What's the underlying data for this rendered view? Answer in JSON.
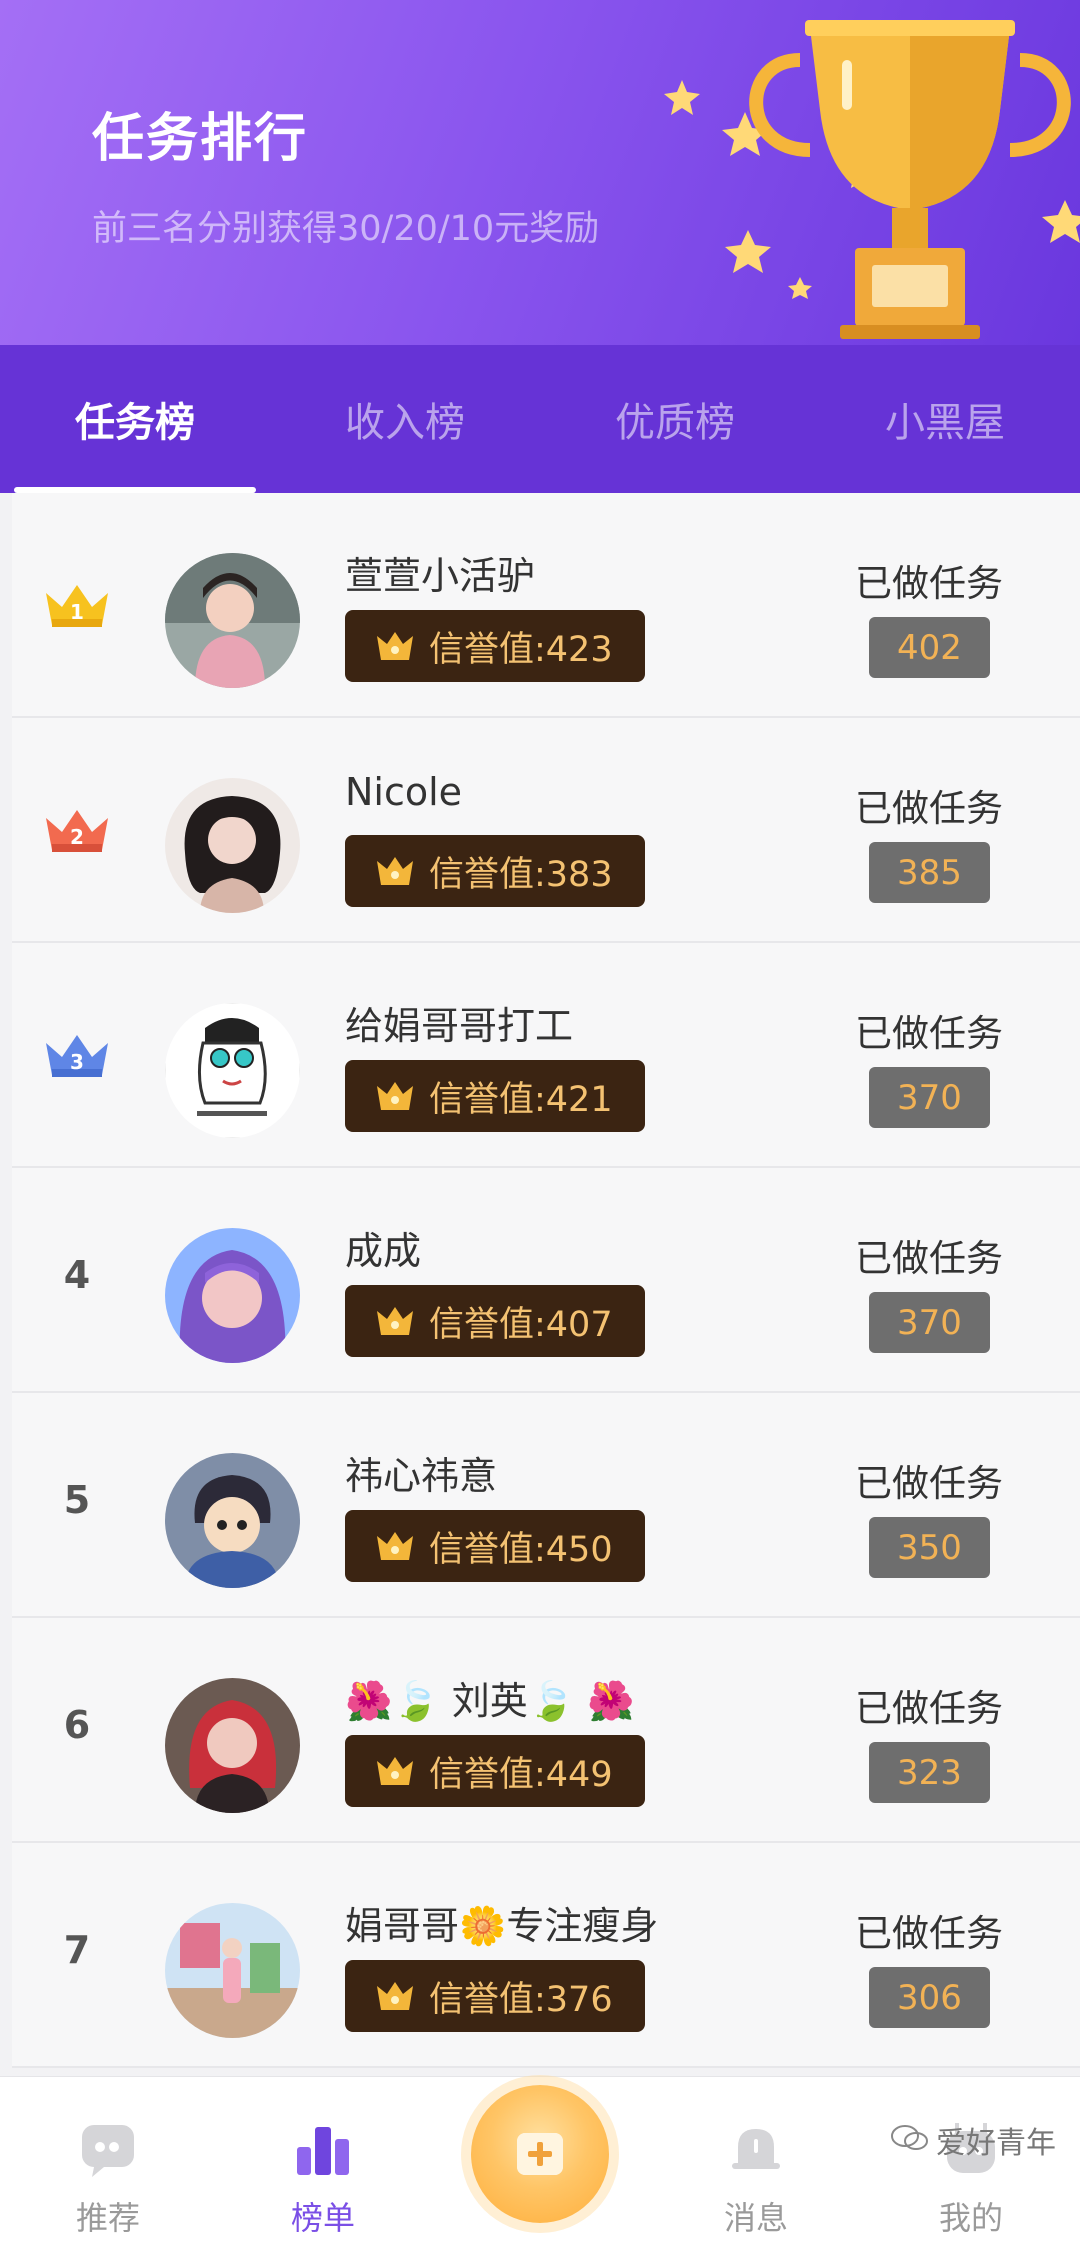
{
  "header": {
    "title": "任务排行",
    "subtitle": "前三名分别获得30/20/10元奖励"
  },
  "tabs": [
    {
      "label": "任务榜",
      "active": true
    },
    {
      "label": "收入榜",
      "active": false
    },
    {
      "label": "优质榜",
      "active": false
    },
    {
      "label": "小黑屋",
      "active": false
    }
  ],
  "done_label": "已做任务",
  "rows": [
    {
      "rank": "1",
      "rank_style": "gold-crown",
      "name": "萱萱小活驴",
      "credit": "信誉值:423",
      "count": "402"
    },
    {
      "rank": "2",
      "rank_style": "red-crown",
      "name": "Nicole",
      "credit": "信誉值:383",
      "count": "385"
    },
    {
      "rank": "3",
      "rank_style": "blue-crown",
      "name": "给娟哥哥打工",
      "credit": "信誉值:421",
      "count": "370"
    },
    {
      "rank": "4",
      "rank_style": "number",
      "name": "成成",
      "credit": "信誉值:407",
      "count": "370"
    },
    {
      "rank": "5",
      "rank_style": "number",
      "name": "祎心祎意",
      "credit": "信誉值:450",
      "count": "350"
    },
    {
      "rank": "6",
      "rank_style": "number",
      "name": "🌺🍃 刘英🍃 🌺",
      "credit": "信誉值:449",
      "count": "323"
    },
    {
      "rank": "7",
      "rank_style": "number",
      "name": "娟哥哥🌼专注瘦身",
      "credit": "信誉值:376",
      "count": "306"
    }
  ],
  "bottom_nav": [
    {
      "label": "推荐",
      "icon": "quote-bubble-icon",
      "active": false
    },
    {
      "label": "榜单",
      "icon": "podium-icon",
      "active": true
    },
    {
      "label": "",
      "icon": "add-task-icon",
      "active": false
    },
    {
      "label": "消息",
      "icon": "bell-icon",
      "active": false
    },
    {
      "label": "我的",
      "icon": "robot-face-icon",
      "active": false
    }
  ],
  "watermark": "爱好青年",
  "colors": {
    "header_purple": "#8a55ee",
    "tab_bar": "#6633d6",
    "badge_bg": "#3b2412",
    "badge_text": "#f4c272",
    "count_pill": "#6e6e6e",
    "count_text": "#f2b255",
    "active_nav": "#7a4fe6"
  }
}
